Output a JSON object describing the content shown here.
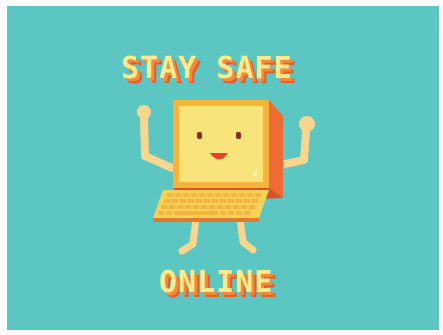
{
  "poster": {
    "headline_top": "STAY SAFE",
    "headline_bottom": "ONLINE",
    "illustration": "smiling-laptop-character-flexing-arms",
    "colors": {
      "background": "#5bc6c2",
      "border": "#ffffff",
      "text_fill": "#f6ec8f",
      "text_shadow": "#f28a3b",
      "text_side": "#e85a2a",
      "screen": "#f8e47b",
      "screen_frame": "#f7b43a",
      "case_side": "#f06a34",
      "keyboard": "#f5d35a",
      "keys": "#f7b23d",
      "limbs": "#f8d68d",
      "eyes": "#8a2f1a",
      "mouth": "#e9432a"
    }
  }
}
